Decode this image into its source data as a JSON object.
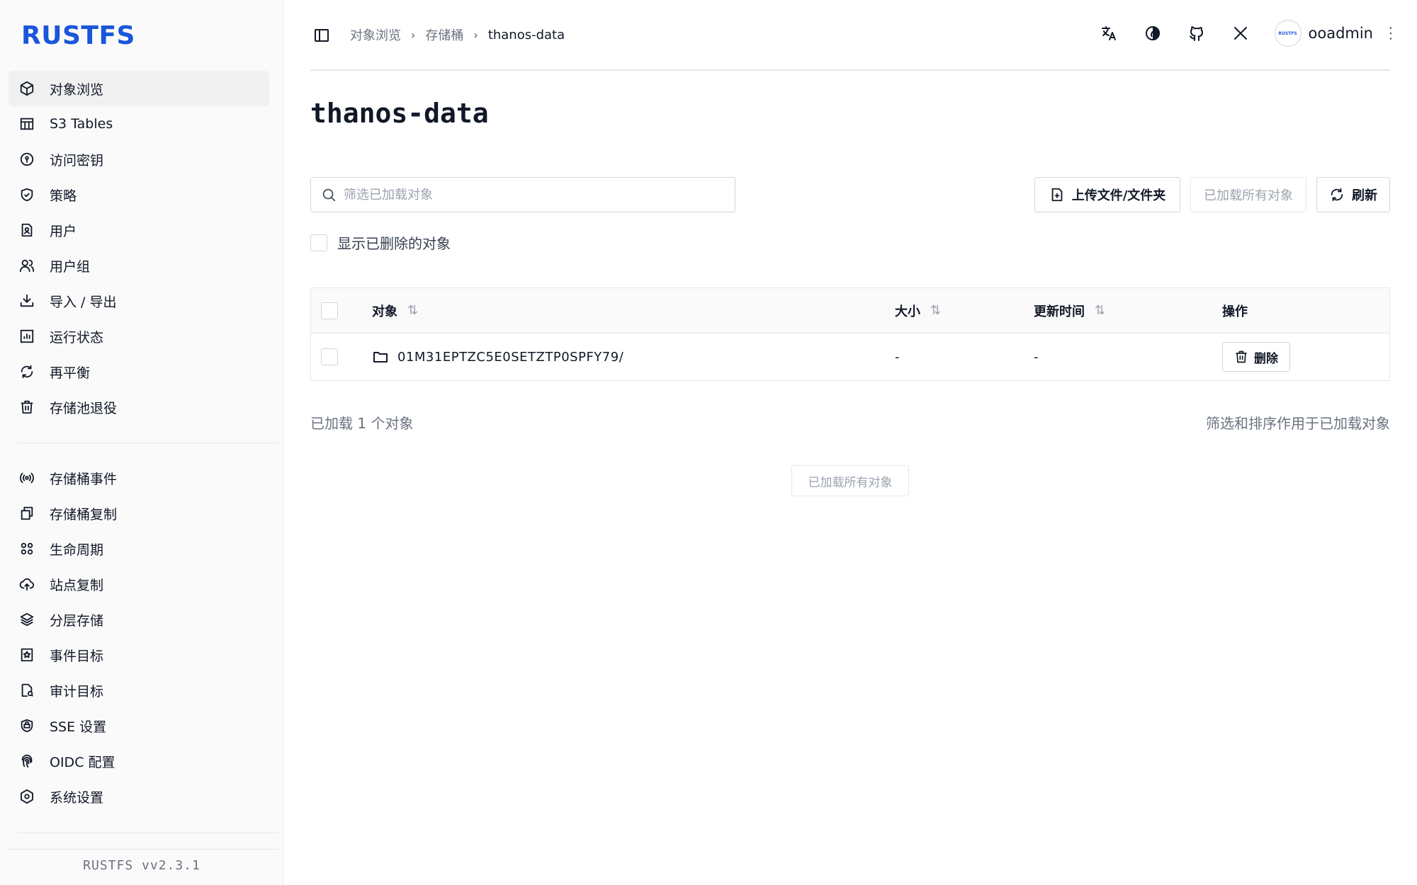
{
  "brand": {
    "logo": "RUSTFS",
    "version": "RUSTFS  vv2.3.1",
    "avatar_text": "RUSTFS"
  },
  "sidebar": {
    "group1": [
      {
        "label": "对象浏览",
        "icon": "cube-icon",
        "active": true
      },
      {
        "label": "S3 Tables",
        "icon": "table-icon"
      },
      {
        "label": "访问密钥",
        "icon": "key-circle-icon"
      },
      {
        "label": "策略",
        "icon": "shield-check-icon"
      },
      {
        "label": "用户",
        "icon": "user-file-icon"
      },
      {
        "label": "用户组",
        "icon": "users-icon"
      },
      {
        "label": "导入 / 导出",
        "icon": "download-icon"
      },
      {
        "label": "运行状态",
        "icon": "chart-icon"
      },
      {
        "label": "再平衡",
        "icon": "refresh-icon"
      },
      {
        "label": "存储池退役",
        "icon": "trash-icon"
      }
    ],
    "group2": [
      {
        "label": "存储桶事件",
        "icon": "broadcast-icon"
      },
      {
        "label": "存储桶复制",
        "icon": "copy-icon"
      },
      {
        "label": "生命周期",
        "icon": "lifecycle-icon"
      },
      {
        "label": "站点复制",
        "icon": "cloud-upload-icon"
      },
      {
        "label": "分层存储",
        "icon": "layers-icon"
      },
      {
        "label": "事件目标",
        "icon": "star-bookmark-icon"
      },
      {
        "label": "审计目标",
        "icon": "file-search-icon"
      },
      {
        "label": "SSE 设置",
        "icon": "encryption-icon"
      },
      {
        "label": "OIDC 配置",
        "icon": "fingerprint-icon"
      },
      {
        "label": "系统设置",
        "icon": "settings-hex-icon"
      }
    ]
  },
  "header": {
    "breadcrumb": [
      "对象浏览",
      "存储桶",
      "thanos-data"
    ],
    "username": "ooadmin"
  },
  "main": {
    "title": "thanos-data",
    "search_placeholder": "筛选已加载对象",
    "upload_label": "上传文件/文件夹",
    "loaded_all_label": "已加载所有对象",
    "refresh_label": "刷新",
    "show_deleted_label": "显示已删除的对象",
    "table": {
      "headers": {
        "object": "对象",
        "size": "大小",
        "updated": "更新时间",
        "actions": "操作"
      },
      "rows": [
        {
          "name": "01M31EPTZC5E0SETZTP0SPFY79/",
          "size": "-",
          "updated": "-",
          "action": "删除"
        }
      ]
    },
    "loaded_count": "已加载 1 个对象",
    "filter_note": "筛选和排序作用于已加载对象",
    "all_loaded_button": "已加载所有对象"
  }
}
